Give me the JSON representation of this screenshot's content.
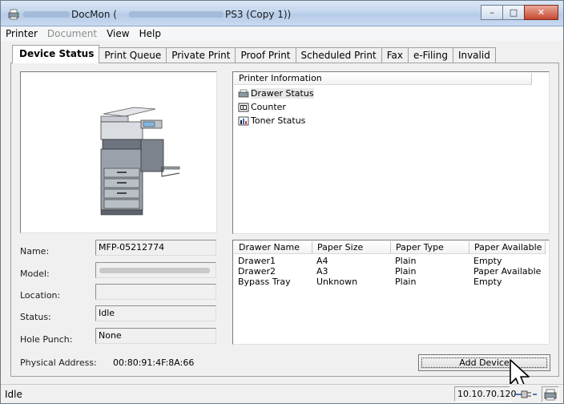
{
  "window": {
    "title_app": "DocMon (",
    "title_suffix": " PS3 (Copy 1))",
    "controls": {
      "minimize": "–",
      "maximize": "□",
      "close": "✕"
    }
  },
  "menu": [
    {
      "label": "Printer",
      "enabled": true
    },
    {
      "label": "Document",
      "enabled": false
    },
    {
      "label": "View",
      "enabled": true
    },
    {
      "label": "Help",
      "enabled": true
    }
  ],
  "tabs": [
    {
      "label": "Device Status",
      "active": true
    },
    {
      "label": "Print Queue",
      "active": false
    },
    {
      "label": "Private Print",
      "active": false
    },
    {
      "label": "Proof Print",
      "active": false
    },
    {
      "label": "Scheduled Print",
      "active": false
    },
    {
      "label": "Fax",
      "active": false
    },
    {
      "label": "e-Filing",
      "active": false
    },
    {
      "label": "Invalid",
      "active": false
    }
  ],
  "tree": {
    "header": "Printer Information",
    "items": [
      {
        "label": "Drawer Status",
        "icon": "drawer-icon",
        "selected": true
      },
      {
        "label": "Counter",
        "icon": "counter-icon",
        "selected": false
      },
      {
        "label": "Toner Status",
        "icon": "toner-icon",
        "selected": false
      }
    ]
  },
  "device": {
    "name_label": "Name:",
    "name_value": "MFP-05212774",
    "model_label": "Model:",
    "location_label": "Location:",
    "location_value": "",
    "status_label": "Status:",
    "status_value": "Idle",
    "hole_punch_label": "Hole Punch:",
    "hole_punch_value": "None",
    "physical_address_label": "Physical Address:",
    "physical_address_value": "00:80:91:4F:8A:66"
  },
  "drawers": {
    "columns": [
      "Drawer Name",
      "Paper Size",
      "Paper Type",
      "Paper Available"
    ],
    "rows": [
      [
        "Drawer1",
        "A4",
        "Plain",
        "Empty"
      ],
      [
        "Drawer2",
        "A3",
        "Plain",
        "Paper Available"
      ],
      [
        "Bypass Tray",
        "Unknown",
        "Plain",
        "Empty"
      ]
    ]
  },
  "buttons": {
    "add_device": "Add Device"
  },
  "statusbar": {
    "text": "Idle",
    "ip": "10.10.70.120"
  }
}
